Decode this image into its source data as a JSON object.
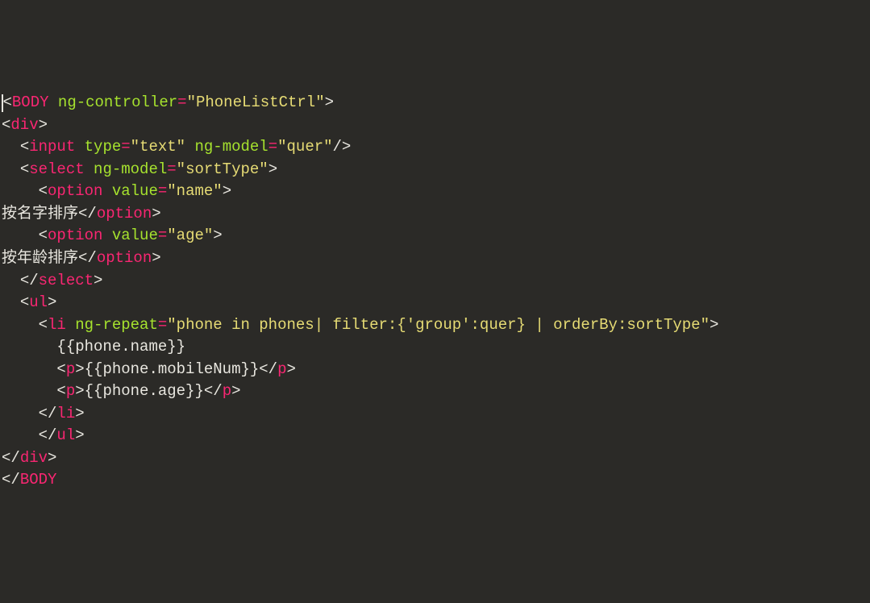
{
  "code": {
    "line1": {
      "open": "<",
      "tag": "BODY",
      "sp": " ",
      "attr": "ng-controller",
      "eq": "=",
      "val": "\"PhoneListCtrl\"",
      "close": ">"
    },
    "line2": {
      "open": "<",
      "tag": "div",
      "close": ">"
    },
    "line3": {
      "indent": "  ",
      "open": "<",
      "tag": "input",
      "sp1": " ",
      "attr1": "type",
      "eq1": "=",
      "val1": "\"text\"",
      "sp2": " ",
      "attr2": "ng-model",
      "eq2": "=",
      "val2": "\"quer\"",
      "selfclose": "/>"
    },
    "line4": {
      "indent": "  ",
      "open": "<",
      "tag": "select",
      "sp": " ",
      "attr": "ng-model",
      "eq": "=",
      "val": "\"sortType\"",
      "close": ">"
    },
    "line5": {
      "indent": "    ",
      "open": "<",
      "tag": "option",
      "sp": " ",
      "attr": "value",
      "eq": "=",
      "val": "\"name\"",
      "close": ">"
    },
    "line6": {
      "text": "按名字排序",
      "open": "</",
      "tag": "option",
      "close": ">"
    },
    "line7": {
      "indent": "    ",
      "open": "<",
      "tag": "option",
      "sp": " ",
      "attr": "value",
      "eq": "=",
      "val": "\"age\"",
      "close": ">"
    },
    "line8": {
      "text": "按年龄排序",
      "open": "</",
      "tag": "option",
      "close": ">"
    },
    "line9": {
      "indent": "  ",
      "open": "</",
      "tag": "select",
      "close": ">"
    },
    "line10": {
      "indent": "  ",
      "open": "<",
      "tag": "ul",
      "close": ">"
    },
    "line11": {
      "indent": "    ",
      "open": "<",
      "tag": "li",
      "sp": " ",
      "attr": "ng-repeat",
      "eq": "=",
      "val": "\"phone in phones| filter:{'group':quer} | orderBy:sortType\"",
      "close": ">"
    },
    "line12": {
      "indent": "      ",
      "text": "{{phone.name}}"
    },
    "line13": {
      "indent": "      ",
      "open1": "<",
      "tag1": "p",
      "close1": ">",
      "text": "{{phone.mobileNum}}",
      "open2": "</",
      "tag2": "p",
      "close2": ">"
    },
    "line14": {
      "indent": "      ",
      "open1": "<",
      "tag1": "p",
      "close1": ">",
      "text": "{{phone.age}}",
      "open2": "</",
      "tag2": "p",
      "close2": ">"
    },
    "line15": {
      "indent": "    ",
      "open": "</",
      "tag": "li",
      "close": ">"
    },
    "line16": {
      "indent": "    ",
      "open": "</",
      "tag": "ul",
      "close": ">"
    },
    "line17": {
      "open": "</",
      "tag": "div",
      "close": ">"
    },
    "line18": {
      "open": "</",
      "tag": "BODY"
    }
  }
}
